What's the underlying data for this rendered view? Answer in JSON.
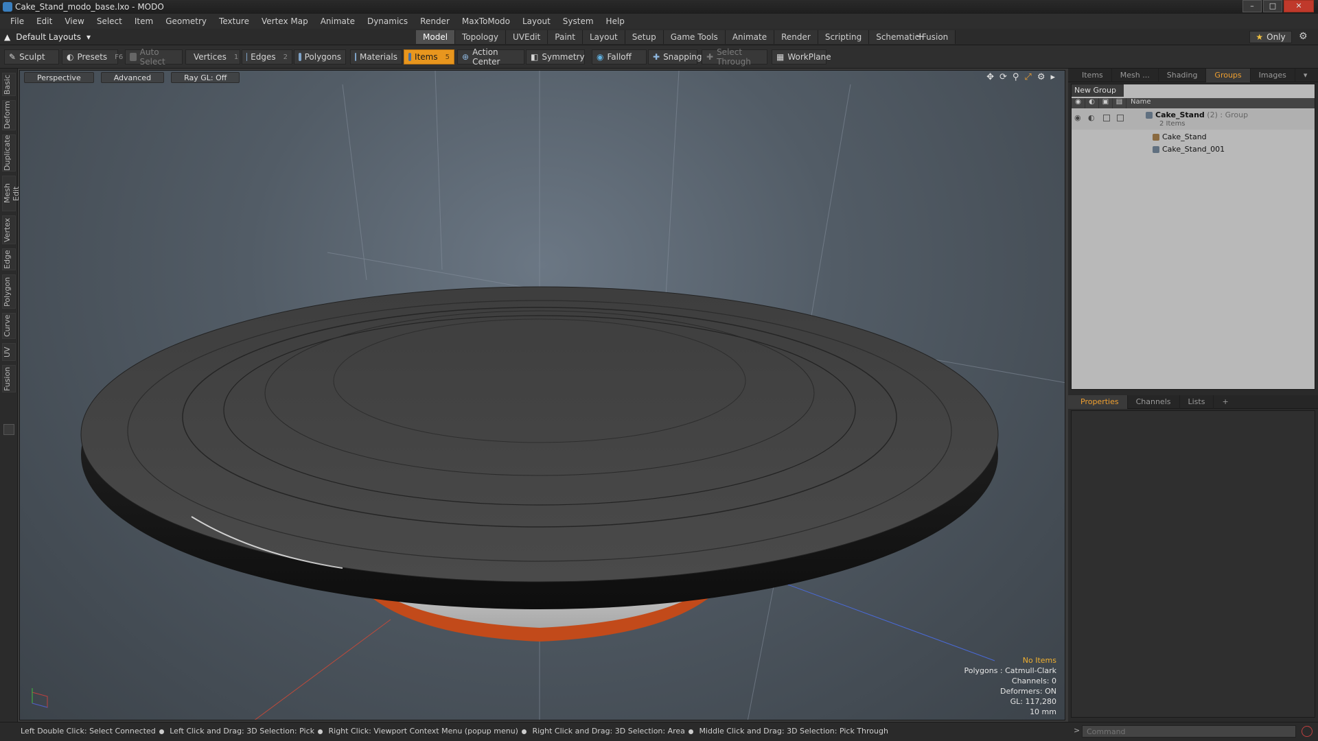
{
  "window": {
    "title": "Cake_Stand_modo_base.lxo - MODO"
  },
  "menu": [
    "File",
    "Edit",
    "View",
    "Select",
    "Item",
    "Geometry",
    "Texture",
    "Vertex Map",
    "Animate",
    "Dynamics",
    "Render",
    "MaxToModo",
    "Layout",
    "System",
    "Help"
  ],
  "layout_picker": {
    "label": "Default Layouts"
  },
  "mode_tabs": [
    "Model",
    "Topology",
    "UVEdit",
    "Paint",
    "Layout",
    "Setup",
    "Game Tools",
    "Animate",
    "Render",
    "Scripting",
    "Schematic Fusion"
  ],
  "only_label": "Only",
  "toolbar": {
    "sculpt": "Sculpt",
    "presets": "Presets",
    "presets_key": "F6",
    "auto_select": "Auto Select",
    "vertices": "Vertices",
    "vertices_key": "1",
    "edges": "Edges",
    "edges_key": "2",
    "polygons": "Polygons",
    "materials": "Materials",
    "items": "Items",
    "items_key": "5",
    "action_center": "Action Center",
    "symmetry": "Symmetry",
    "falloff": "Falloff",
    "snapping": "Snapping",
    "select_through": "Select Through",
    "workplane": "WorkPlane"
  },
  "left_tabs": [
    "Basic",
    "Deform",
    "Duplicate",
    "Mesh Edit",
    "Vertex",
    "Edge",
    "Polygon",
    "Curve",
    "UV",
    "Fusion"
  ],
  "viewport": {
    "view": "Perspective",
    "style": "Advanced",
    "raygl": "Ray GL: Off",
    "info": {
      "selection": "No Items",
      "polygons": "Polygons : Catmull-Clark",
      "channels": "Channels: 0",
      "deformers": "Deformers: ON",
      "gl": "GL: 117,280",
      "scale": "10 mm"
    }
  },
  "status": {
    "hints": [
      "Left Double Click: Select Connected",
      "Left Click and Drag: 3D Selection: Pick",
      "Right Click: Viewport Context Menu (popup menu)",
      "Right Click and Drag: 3D Selection: Area",
      "Middle Click and Drag: 3D Selection: Pick Through"
    ]
  },
  "right_panel": {
    "top_tabs": [
      "Items",
      "Mesh ...",
      "Shading",
      "Groups",
      "Images"
    ],
    "active_top_tab": "Groups",
    "new_group": "New Group",
    "name_header": "Name",
    "group": {
      "name": "Cake_Stand",
      "count": "(2)",
      "type": ": Group",
      "subtitle": "2 Items"
    },
    "children": [
      "Cake_Stand",
      "Cake_Stand_001"
    ],
    "bottom_tabs": [
      "Properties",
      "Channels",
      "Lists"
    ],
    "active_bottom_tab": "Properties"
  },
  "command": {
    "placeholder": "Command",
    "prompt": ">"
  }
}
